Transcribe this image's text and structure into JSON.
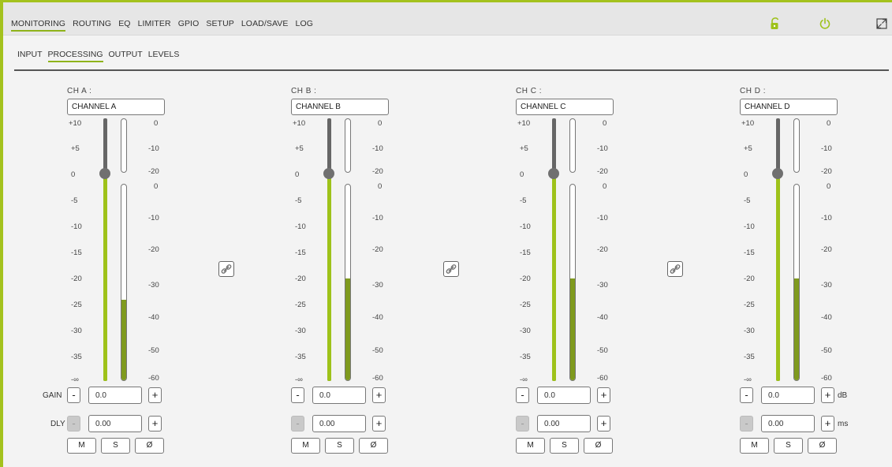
{
  "nav": {
    "main": [
      "MONITORING",
      "ROUTING",
      "EQ",
      "LIMITER",
      "GPIO",
      "SETUP",
      "LOAD/SAVE",
      "LOG"
    ],
    "main_active": 0,
    "sub": [
      "INPUT",
      "PROCESSING",
      "OUTPUT",
      "LEVELS"
    ],
    "sub_active": 1
  },
  "icons": {
    "lock": "unlock-icon",
    "power": "power-icon",
    "expand": "fullscreen-icon",
    "link": "link-icon"
  },
  "colors": {
    "accent": "#9ec21a",
    "meter": "#7f9a1e"
  },
  "fader_scale": [
    "+10",
    "+5",
    "0",
    "-5",
    "-10",
    "-15",
    "-20",
    "-25",
    "-30",
    "-35",
    "-∞"
  ],
  "limiter_scale": [
    "0",
    "-10",
    "-20"
  ],
  "meter_scale": [
    "0",
    "-10",
    "-20",
    "-30",
    "-40",
    "-50",
    "-60"
  ],
  "labels": {
    "gain": "GAIN",
    "dly": "DLY",
    "minus": "-",
    "plus": "+",
    "unit_db": "dB",
    "unit_ms": "ms"
  },
  "channels": [
    {
      "label": "CH A :",
      "name": "CHANNEL A",
      "gain": "0.0",
      "delay": "0.00",
      "fader_db": 0,
      "meter_level": 0.41,
      "buttons": [
        "M",
        "S",
        "Ø"
      ]
    },
    {
      "label": "CH B :",
      "name": "CHANNEL B",
      "gain": "0.0",
      "delay": "0.00",
      "fader_db": 0,
      "meter_level": 0.52,
      "buttons": [
        "M",
        "S",
        "Ø"
      ]
    },
    {
      "label": "CH C :",
      "name": "CHANNEL C",
      "gain": "0.0",
      "delay": "0.00",
      "fader_db": 0,
      "meter_level": 0.52,
      "buttons": [
        "M",
        "S",
        "Ø"
      ]
    },
    {
      "label": "CH D :",
      "name": "CHANNEL D",
      "gain": "0.0",
      "delay": "0.00",
      "fader_db": 0,
      "meter_level": 0.52,
      "buttons": [
        "M",
        "S",
        "Ø"
      ]
    }
  ]
}
